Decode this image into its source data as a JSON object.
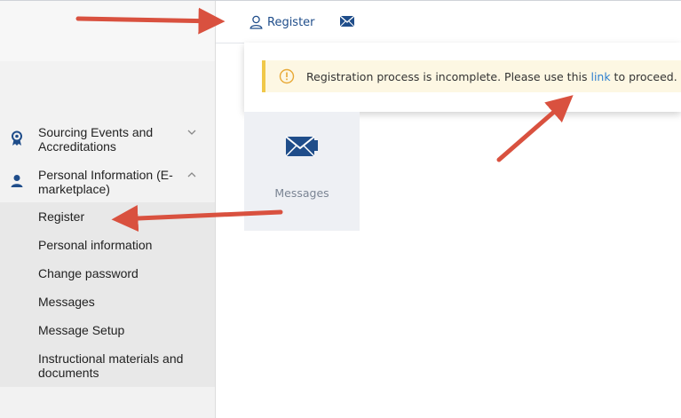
{
  "topbar": {
    "register_label": "Register",
    "register_icon": "user-icon",
    "mail_icon": "envelope-icon"
  },
  "notice": {
    "text_before": "Registration process is incomplete. Please use this ",
    "link_text": "link",
    "text_after": " to proceed.",
    "icon": "warning-icon"
  },
  "tile": {
    "label": "Messages",
    "icon": "envelope-icon"
  },
  "sidebar": {
    "groups": [
      {
        "label": "Sourcing Events and Accreditations",
        "icon": "award-ribbon-icon",
        "expanded": false
      },
      {
        "label": "Personal Information (E-marketplace)",
        "icon": "person-icon",
        "expanded": true
      }
    ],
    "submenu": [
      {
        "label": "Register"
      },
      {
        "label": "Personal information"
      },
      {
        "label": "Change password"
      },
      {
        "label": "Messages"
      },
      {
        "label": "Message Setup"
      },
      {
        "label": "Instructional materials and documents"
      }
    ]
  },
  "colors": {
    "brand_blue": "#1f4d8a",
    "link_blue": "#2e7fd0",
    "notice_bg": "#fdf7e3",
    "notice_border": "#f0c84a",
    "arrow_red": "#d9513f"
  }
}
